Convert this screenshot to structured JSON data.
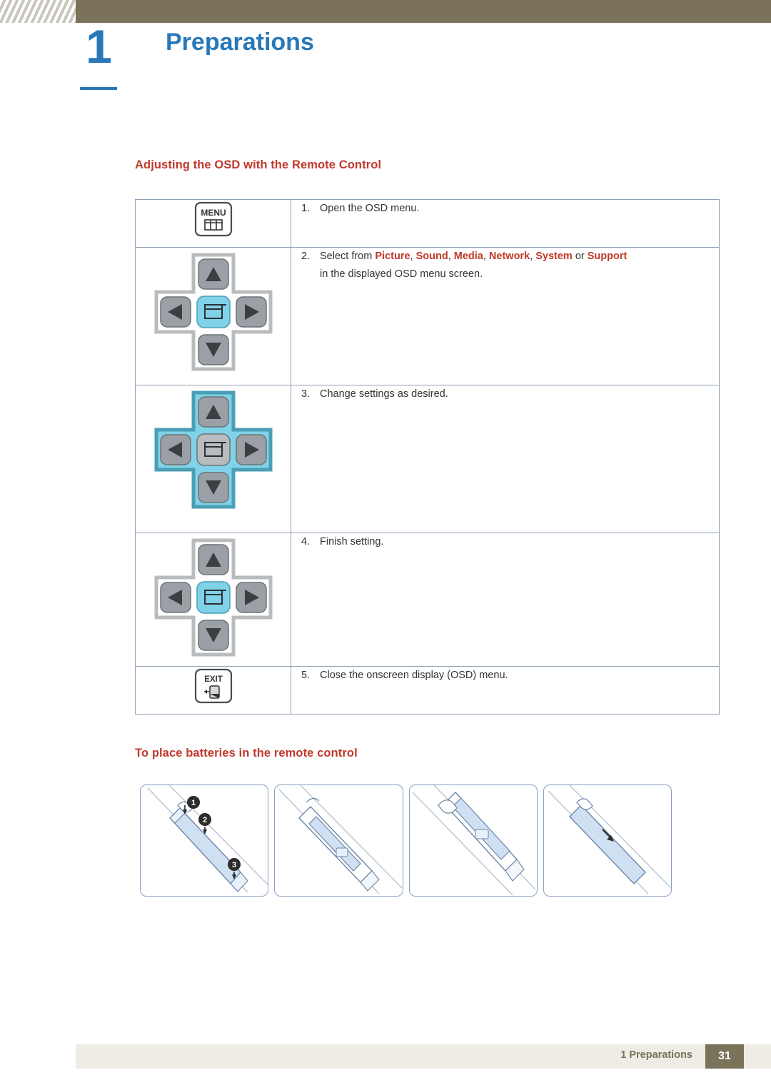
{
  "header": {
    "chapter_number": "1",
    "chapter_title": "Preparations"
  },
  "sections": {
    "osd_title": "Adjusting the OSD with the Remote Control",
    "battery_title": "To place batteries in the remote control"
  },
  "osd_table": {
    "rows": [
      {
        "icon": "menu-button",
        "icon_label": "MENU",
        "number": "1.",
        "text": "Open the OSD menu.",
        "text2": ""
      },
      {
        "icon": "dpad-center-highlight",
        "icon_label": "",
        "number": "2.",
        "text_prefix": "Select from ",
        "keywords": [
          "Picture",
          "Sound",
          "Media",
          "Network",
          "System"
        ],
        "text_or": " or ",
        "keyword_last": "Support",
        "text2": "in the displayed OSD menu screen."
      },
      {
        "icon": "dpad-all-highlight",
        "icon_label": "",
        "number": "3.",
        "text": "Change settings as desired.",
        "text2": ""
      },
      {
        "icon": "dpad-center-only-highlight",
        "icon_label": "",
        "number": "4.",
        "text": "Finish setting.",
        "text2": ""
      },
      {
        "icon": "exit-button",
        "icon_label": "EXIT",
        "number": "5.",
        "text": "Close the onscreen display (OSD) menu.",
        "text2": ""
      }
    ]
  },
  "battery_steps": [
    {
      "name": "battery-step-1",
      "callouts": [
        "1",
        "2",
        "3"
      ]
    },
    {
      "name": "battery-step-2",
      "callouts": []
    },
    {
      "name": "battery-step-3",
      "callouts": []
    },
    {
      "name": "battery-step-4",
      "callouts": []
    }
  ],
  "footer": {
    "label": "1 Preparations",
    "page": "31"
  },
  "colors": {
    "accent_blue": "#2878b8",
    "accent_red": "#c0392b",
    "header_bar": "#7a7259",
    "table_border": "#8fa0b5",
    "highlight_cyan": "#7fd2e8"
  }
}
